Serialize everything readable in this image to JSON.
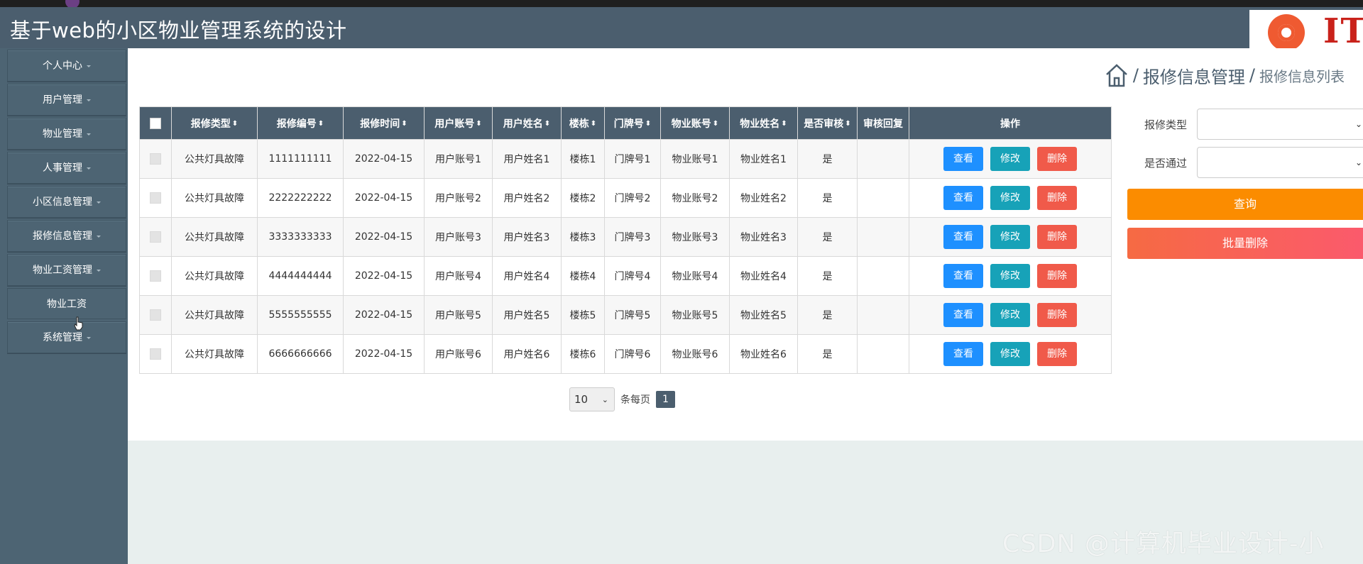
{
  "app": {
    "title": "基于web的小区物业管理系统的设计",
    "logo_text": "IT"
  },
  "sidebar": {
    "items": [
      {
        "label": "个人中心"
      },
      {
        "label": "用户管理"
      },
      {
        "label": "物业管理"
      },
      {
        "label": "人事管理"
      },
      {
        "label": "小区信息管理"
      },
      {
        "label": "报修信息管理"
      },
      {
        "label": "物业工资管理"
      }
    ],
    "submenu_label": "物业工资",
    "last_item": "系统管理"
  },
  "breadcrumb": {
    "separator": "/",
    "level1": "报修信息管理",
    "level2": "报修信息列表"
  },
  "table": {
    "columns": [
      "报修类型",
      "报修编号",
      "报修时间",
      "用户账号",
      "用户姓名",
      "楼栋",
      "门牌号",
      "物业账号",
      "物业姓名",
      "是否审核",
      "审核回复",
      "操作"
    ],
    "rows": [
      [
        "公共灯具故障",
        "1111111111",
        "2022-04-15",
        "用户账号1",
        "用户姓名1",
        "楼栋1",
        "门牌号1",
        "物业账号1",
        "物业姓名1",
        "是",
        ""
      ],
      [
        "公共灯具故障",
        "2222222222",
        "2022-04-15",
        "用户账号2",
        "用户姓名2",
        "楼栋2",
        "门牌号2",
        "物业账号2",
        "物业姓名2",
        "是",
        ""
      ],
      [
        "公共灯具故障",
        "3333333333",
        "2022-04-15",
        "用户账号3",
        "用户姓名3",
        "楼栋3",
        "门牌号3",
        "物业账号3",
        "物业姓名3",
        "是",
        ""
      ],
      [
        "公共灯具故障",
        "4444444444",
        "2022-04-15",
        "用户账号4",
        "用户姓名4",
        "楼栋4",
        "门牌号4",
        "物业账号4",
        "物业姓名4",
        "是",
        ""
      ],
      [
        "公共灯具故障",
        "5555555555",
        "2022-04-15",
        "用户账号5",
        "用户姓名5",
        "楼栋5",
        "门牌号5",
        "物业账号5",
        "物业姓名5",
        "是",
        ""
      ],
      [
        "公共灯具故障",
        "6666666666",
        "2022-04-15",
        "用户账号6",
        "用户姓名6",
        "楼栋6",
        "门牌号6",
        "物业账号6",
        "物业姓名6",
        "是",
        ""
      ]
    ],
    "actions": {
      "view": "查看",
      "edit": "修改",
      "delete": "删除"
    }
  },
  "pagination": {
    "page_size": "10",
    "per_page_label": "条每页",
    "current_page": "1"
  },
  "filters": {
    "repair_type_label": "报修类型",
    "approved_label": "是否通过",
    "query_label": "查询",
    "batch_delete_label": "批量删除"
  },
  "watermark": "CSDN @计算机毕业设计-小ma",
  "colors": {
    "header": "#4b5e6e",
    "sidebar": "#4d6473",
    "view_button": "#1e90ff",
    "edit_button": "#17a2b8",
    "delete_button": "#f05a4a",
    "query_button": "#fb8c00"
  }
}
